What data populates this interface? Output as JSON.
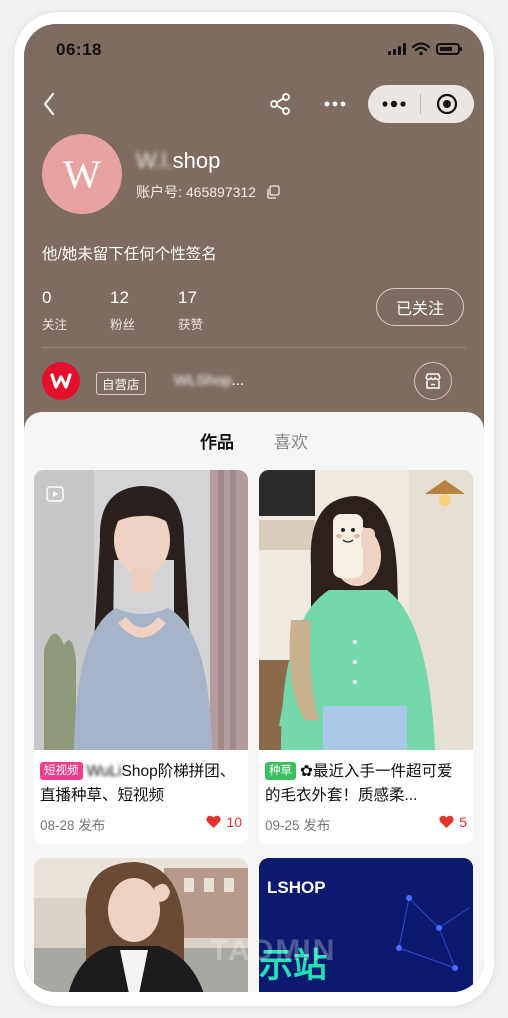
{
  "status_bar": {
    "time": "06:18"
  },
  "profile": {
    "avatar_letter": "W",
    "username_prefix": "W.l.",
    "username_suffix": "shop",
    "account_label": "账户号:",
    "account_id": "465897312",
    "bio": "他/她未留下任何个性签名",
    "stats": [
      {
        "value": "0",
        "label": "关注"
      },
      {
        "value": "12",
        "label": "粉丝"
      },
      {
        "value": "17",
        "label": "获赞"
      }
    ],
    "follow_label": "已关注"
  },
  "shop": {
    "badge": "自营店",
    "name_blurred": "WLShop",
    "name_suffix": "..."
  },
  "tabs": [
    {
      "label": "作品"
    },
    {
      "label": "喜欢"
    }
  ],
  "posts": [
    {
      "tag": "短视频",
      "tag_color": "#ef3f8c",
      "title_blurred": "WuLi",
      "title": "Shop阶梯拼团、直播种草、短视频",
      "date": "08-28 发布",
      "likes": "10"
    },
    {
      "tag": "种草",
      "tag_color": "#3bc060",
      "title": "✿最近入手一件超可爱的毛衣外套！质感柔...",
      "date": "09-25 发布",
      "likes": "5"
    },
    {
      "banner_text": "LSHOP",
      "banner_sub": "示站"
    }
  ],
  "watermark": "TADMIN",
  "icons": [
    "back-icon",
    "share-icon",
    "more-icon",
    "capsule-close-icon",
    "copy-icon",
    "store-icon",
    "video-icon",
    "heart-icon"
  ],
  "colors": {
    "header_bg": "#7e6c62",
    "avatar_bg": "#e8a3a0",
    "shop_logo": "#e2102a",
    "like": "#e8322f"
  }
}
